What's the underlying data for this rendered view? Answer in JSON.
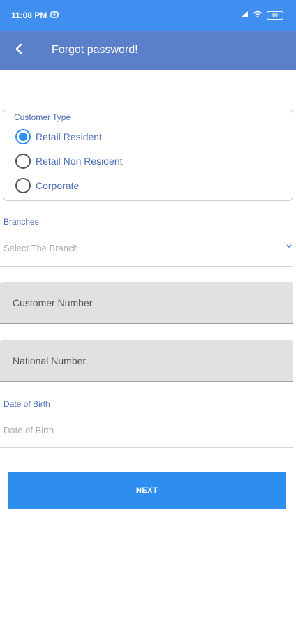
{
  "status_bar": {
    "time": "11:08 PM",
    "battery_text": "80",
    "icons": [
      "notification-icon",
      "signal-icon",
      "wifi-icon",
      "battery-icon"
    ]
  },
  "app_bar": {
    "title": "Forgot password!",
    "back_icon": "chevron-left-icon"
  },
  "customer_type": {
    "label": "Customer Type",
    "options": [
      {
        "label": "Retail Resident",
        "selected": true
      },
      {
        "label": "Retail Non Resident",
        "selected": false
      },
      {
        "label": "Corporate",
        "selected": false
      }
    ]
  },
  "branches": {
    "label": "Branches",
    "placeholder": "Select The Branch"
  },
  "customer_number": {
    "placeholder": "Customer Number"
  },
  "national_number": {
    "placeholder": "National Number"
  },
  "date_of_birth": {
    "label": "Date of Birth",
    "placeholder": "Date of Birth"
  },
  "next_button": {
    "label": "NEXT"
  },
  "colors": {
    "status_bar": "#3f8ef0",
    "app_bar": "#5b80c9",
    "accent": "#2d8ef0",
    "label_text": "#4a6fb5",
    "input_fill": "#e1e1e1"
  }
}
